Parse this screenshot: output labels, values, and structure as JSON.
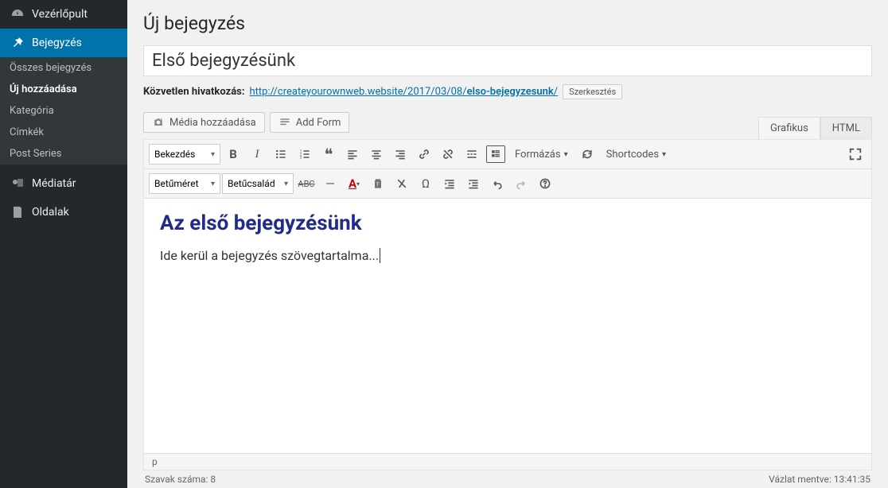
{
  "sidebar": {
    "dashboard": "Vezérlőpult",
    "posts": "Bejegyzés",
    "sub": {
      "all": "Összes bejegyzés",
      "new": "Új hozzáadása",
      "cat": "Kategória",
      "tags": "Címkék",
      "series": "Post Series"
    },
    "media": "Médiatár",
    "pages": "Oldalak"
  },
  "page": {
    "title": "Új bejegyzés",
    "post_title": "Első bejegyzésünk",
    "permalink_label": "Közvetlen hivatkozás:",
    "permalink_base": "http://createyourownweb.website/2017/03/08/",
    "permalink_slug": "elso-bejegyzesunk",
    "permalink_trail": "/",
    "edit_btn": "Szerkesztés",
    "media_btn": "Média hozzáadása",
    "add_form_btn": "Add Form",
    "tab_visual": "Grafikus",
    "tab_html": "HTML"
  },
  "toolbar": {
    "paragraph": "Bekezdés",
    "formats": "Formázás",
    "shortcodes": "Shortcodes",
    "fontsize": "Betűméret",
    "fontfamily": "Betűcsalád"
  },
  "content": {
    "heading": "Az első bejegyzésünk",
    "body": "Ide kerül a bejegyzés szövegtartalma..."
  },
  "status": {
    "path": "p",
    "wordcount": "Szavak száma: 8",
    "saved": "Vázlat mentve: 13:41:35"
  }
}
